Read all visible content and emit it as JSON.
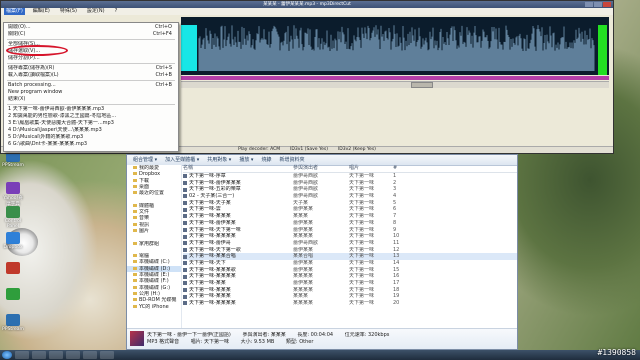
{
  "app": {
    "title": "某某某 - 蕾伊某某某.mp3 - mp3DirectCut",
    "menu": [
      "檔案(F)",
      "編輯(E)",
      "特殊(S)",
      "設定(N)",
      "?"
    ]
  },
  "file_menu": {
    "items": [
      {
        "label": "開啟(O)...",
        "shortcut": "Ctrl+O"
      },
      {
        "label": "關閉(C)",
        "shortcut": "Ctrl+F4"
      },
      {
        "sep": true
      },
      {
        "label": "全部儲存(S)...",
        "shortcut": ""
      },
      {
        "label": "儲存選取(V)...",
        "shortcut": ""
      },
      {
        "label": "儲存分割(P)...",
        "shortcut": ""
      },
      {
        "sep": true
      },
      {
        "label": "儲存專案(儲存為)(R)",
        "shortcut": "Ctrl+S"
      },
      {
        "label": "載入專案(讀取檔案)(L)",
        "shortcut": "Ctrl+B"
      },
      {
        "sep": true
      },
      {
        "label": "Batch processing...",
        "shortcut": "Ctrl+B"
      },
      {
        "label": "New program window",
        "shortcut": ""
      },
      {
        "label": "結束(X)",
        "shortcut": ""
      },
      {
        "sep": true
      },
      {
        "label": "1 天下第一味-蕾伊哥西歐-蕾伊某某某.mp3",
        "shortcut": ""
      },
      {
        "label": "2 知識萬能的男性戀歌-漆黑之王國篇-冬陰地區...",
        "shortcut": ""
      },
      {
        "label": "3 E:\\鳳凰歌集-天使惡魔大合體-天下第一...mp3",
        "shortcut": ""
      },
      {
        "label": "4 D:\\Musical\\Jasper\\天使...\\某某某.mp3",
        "shortcut": ""
      },
      {
        "label": "5 D:\\Musical\\外籍的某某歌.mp3",
        "shortcut": ""
      },
      {
        "label": "6 G:\\歌曲\\Dnt卡-某某-某某某.mp3",
        "shortcut": ""
      }
    ]
  },
  "status": {
    "decoder": "Play decoder: ACM",
    "id3v1": "ID3v1 (Save Yes)",
    "id3v2": "ID3v2 (Keep Yes)"
  },
  "explorer": {
    "toolbar": [
      "組合管理 ▾",
      "加入至媒體櫃 ▾",
      "共用對象 ▾",
      "播放 ▾",
      "燒錄",
      "新增資料夾"
    ],
    "nav": [
      {
        "label": "我的最愛",
        "sel": false
      },
      {
        "label": "Dropbox",
        "sel": false
      },
      {
        "label": "下載",
        "sel": false
      },
      {
        "label": "桌面",
        "sel": false
      },
      {
        "label": "最近的位置",
        "sel": false
      },
      {
        "label": "",
        "sel": false
      },
      {
        "label": "媒體櫃",
        "sel": false
      },
      {
        "label": "文件",
        "sel": false
      },
      {
        "label": "音樂",
        "sel": false
      },
      {
        "label": "視訊",
        "sel": false
      },
      {
        "label": "圖片",
        "sel": false
      },
      {
        "label": "",
        "sel": false
      },
      {
        "label": "家用群組",
        "sel": false
      },
      {
        "label": "",
        "sel": false
      },
      {
        "label": "電腦",
        "sel": false
      },
      {
        "label": "本機磁碟 (C:)",
        "sel": false
      },
      {
        "label": "本機磁碟 (D:)",
        "sel": true
      },
      {
        "label": "本機磁碟 (E:)",
        "sel": false
      },
      {
        "label": "本機磁碟 (F:)",
        "sel": false
      },
      {
        "label": "本機磁碟 (G:)",
        "sel": false
      },
      {
        "label": "公用 (H:)",
        "sel": false
      },
      {
        "label": "BD-ROM 光碟機",
        "sel": false
      },
      {
        "label": "YC的 iPhone",
        "sel": false
      }
    ],
    "headers": [
      "名稱",
      "參與演出者",
      "唱片",
      "#"
    ],
    "files": [
      {
        "name": "天下第一味-序章",
        "artist": "蕾伊哥西歐",
        "album": "天下第一味",
        "num": "1"
      },
      {
        "name": "天下第一味-蕾伊某某某",
        "artist": "蕾伊哥西歐",
        "album": "天下第一味",
        "num": "2"
      },
      {
        "name": "天下第一味-五彩的樂章",
        "artist": "蕾伊哥西歐",
        "album": "天下第一味",
        "num": "3"
      },
      {
        "name": "02 - 天子某(三合一)",
        "artist": "蕾伊哥西歐",
        "album": "天下第一味",
        "num": "4"
      },
      {
        "name": "天下第一味-天子某",
        "artist": "天子某",
        "album": "天下第一味",
        "num": "5"
      },
      {
        "name": "天下第一味-雲",
        "artist": "蕾伊某某",
        "album": "天下第一味",
        "num": "6"
      },
      {
        "name": "天下第一味-某某某",
        "artist": "某某某",
        "album": "天下第一味",
        "num": "7"
      },
      {
        "name": "天下第一味-蕾伊某某",
        "artist": "蕾伊某某",
        "album": "天下第一味",
        "num": "8"
      },
      {
        "name": "天下第一味-天下第一味",
        "artist": "蕾伊某某",
        "album": "天下第一味",
        "num": "9"
      },
      {
        "name": "天下第一味-某某某某",
        "artist": "某某某某",
        "album": "天下第一味",
        "num": "10"
      },
      {
        "name": "天下第一味-蕾伊哥",
        "artist": "蕾伊哥西歐",
        "album": "天下第一味",
        "num": "11"
      },
      {
        "name": "天下第一味-天下第一歌",
        "artist": "蕾伊某某",
        "album": "天下第一味",
        "num": "12"
      },
      {
        "name": "天下第一味-某某合唱",
        "artist": "某某合唱",
        "album": "天下第一味",
        "num": "13"
      },
      {
        "name": "天下第一味-天下",
        "artist": "蕾伊某某",
        "album": "天下第一味",
        "num": "14"
      },
      {
        "name": "天下第一味-某某某歌",
        "artist": "蕾伊某某",
        "album": "天下第一味",
        "num": "15"
      },
      {
        "name": "天下第一味-某某某某",
        "artist": "某某某某",
        "album": "天下第一味",
        "num": "16"
      },
      {
        "name": "天下第一味-某某",
        "artist": "蕾伊某某",
        "album": "天下第一味",
        "num": "17"
      },
      {
        "name": "天下第一味-某某某",
        "artist": "某某某某",
        "album": "天下第一味",
        "num": "18"
      },
      {
        "name": "天下第一味-某某某",
        "artist": "某某某",
        "album": "天下第一味",
        "num": "19"
      },
      {
        "name": "天下第一味-某某某某",
        "artist": "某某某某",
        "album": "天下第一味",
        "num": "20"
      }
    ],
    "details": {
      "title": "天下第一味 - 蕾伊一下一蕾伊(正國語)",
      "type": "MP3 格式聲音",
      "artist_label": "參與演出者: 某某某",
      "album_label": "唱片: 天下第一味",
      "length_label": "長度: 00:04:04",
      "size_label": "大小: 9.53 MB",
      "bitrate_label": "位元速率: 320kbps",
      "genre_label": "類型: Other"
    }
  },
  "desktop_icons": [
    "PPStream",
    "Yahoo!奇摩字典",
    "Control Panel",
    "Dropbox",
    "",
    "",
    "PPStream"
  ],
  "watermark": "#1390858"
}
